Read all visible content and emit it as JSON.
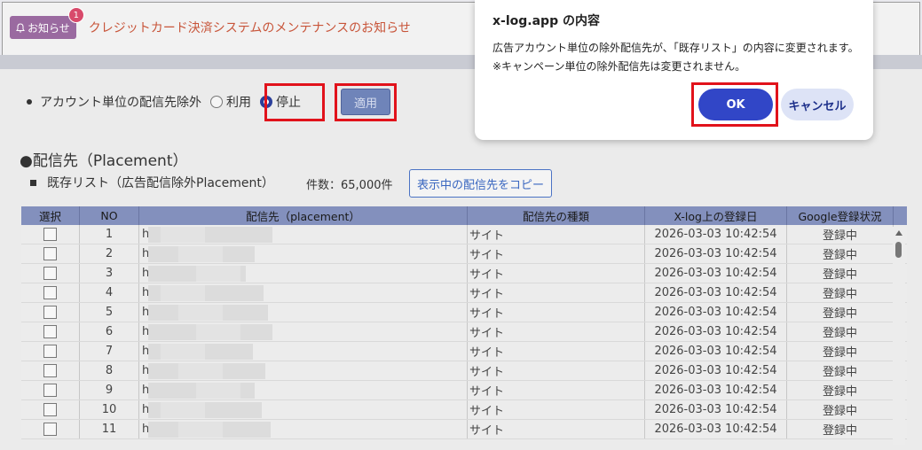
{
  "notice": {
    "button_label": "お知らせ",
    "badge_count": "1",
    "link_text": "クレジットカード決済システムのメンテナンスのお知らせ"
  },
  "exclusion": {
    "label": "アカウント単位の配信先除外",
    "option_use": "利用",
    "option_stop": "停止",
    "selected": "停止",
    "apply_label": "適用"
  },
  "placement": {
    "section_title": "●配信先（Placement）",
    "list_label": "既存リスト（広告配信除外Placement）",
    "count_text": "件数：65,000件",
    "copy_button": "表示中の配信先をコピー"
  },
  "table": {
    "headers": [
      "選択",
      "NO",
      "配信先（placement）",
      "配信先の種類",
      "X-log上の登録日",
      "Google登録状況"
    ],
    "rows": [
      {
        "no": "1",
        "placement": "h",
        "type": "サイト",
        "date": "2026-03-03 10:42:54",
        "status": "登録中"
      },
      {
        "no": "2",
        "placement": "h",
        "type": "サイト",
        "date": "2026-03-03 10:42:54",
        "status": "登録中"
      },
      {
        "no": "3",
        "placement": "h",
        "type": "サイト",
        "date": "2026-03-03 10:42:54",
        "status": "登録中"
      },
      {
        "no": "4",
        "placement": "h",
        "type": "サイト",
        "date": "2026-03-03 10:42:54",
        "status": "登録中"
      },
      {
        "no": "5",
        "placement": "h",
        "type": "サイト",
        "date": "2026-03-03 10:42:54",
        "status": "登録中"
      },
      {
        "no": "6",
        "placement": "h",
        "type": "サイト",
        "date": "2026-03-03 10:42:54",
        "status": "登録中"
      },
      {
        "no": "7",
        "placement": "h",
        "type": "サイト",
        "date": "2026-03-03 10:42:54",
        "status": "登録中"
      },
      {
        "no": "8",
        "placement": "h",
        "type": "サイト",
        "date": "2026-03-03 10:42:54",
        "status": "登録中"
      },
      {
        "no": "9",
        "placement": "h",
        "type": "サイト",
        "date": "2026-03-03 10:42:54",
        "status": "登録中"
      },
      {
        "no": "10",
        "placement": "h",
        "type": "サイト",
        "date": "2026-03-03 10:42:54",
        "status": "登録中"
      },
      {
        "no": "11",
        "placement": "h",
        "type": "サイト",
        "date": "2026-03-03 10:42:54",
        "status": "登録中"
      }
    ]
  },
  "dialog": {
    "title": "x-log.app の内容",
    "message": "広告アカウント単位の除外配信先が、「既存リスト」の内容に変更されます。※キャンペーン単位の除外配信先は変更されません。",
    "ok_label": "OK",
    "cancel_label": "キャンセル"
  },
  "colors": {
    "highlight_box": "#e1121b",
    "ok_button": "#3146c7",
    "notice_link": "#c8553a",
    "table_header": "#8390bd"
  }
}
